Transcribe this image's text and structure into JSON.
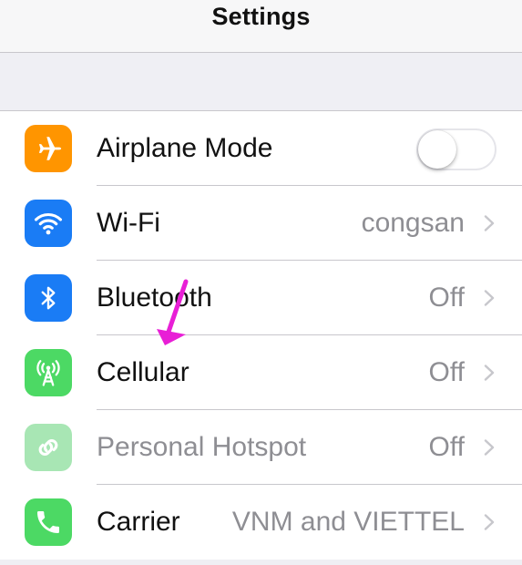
{
  "navbar": {
    "title": "Settings"
  },
  "colors": {
    "airplane": "#ff9500",
    "wifi": "#1a7cf5",
    "bluetooth": "#1a7cf5",
    "cellular": "#4cd964",
    "hotspot": "#a8e6b4",
    "carrier": "#4cd964",
    "annotation_arrow": "#e81fd6"
  },
  "rows": [
    {
      "label": "Airplane Mode",
      "icon": "airplane-icon",
      "control": "toggle",
      "toggle_on": false
    },
    {
      "label": "Wi-Fi",
      "value": "congsan",
      "icon": "wifi-icon"
    },
    {
      "label": "Bluetooth",
      "value": "Off",
      "icon": "bluetooth-icon"
    },
    {
      "label": "Cellular",
      "value": "Off",
      "icon": "cellular-antenna-icon"
    },
    {
      "label": "Personal Hotspot",
      "value": "Off",
      "icon": "hotspot-chain-icon",
      "disabled": true
    },
    {
      "label": "Carrier",
      "value": "VNM and VIETTEL",
      "icon": "phone-icon"
    }
  ]
}
